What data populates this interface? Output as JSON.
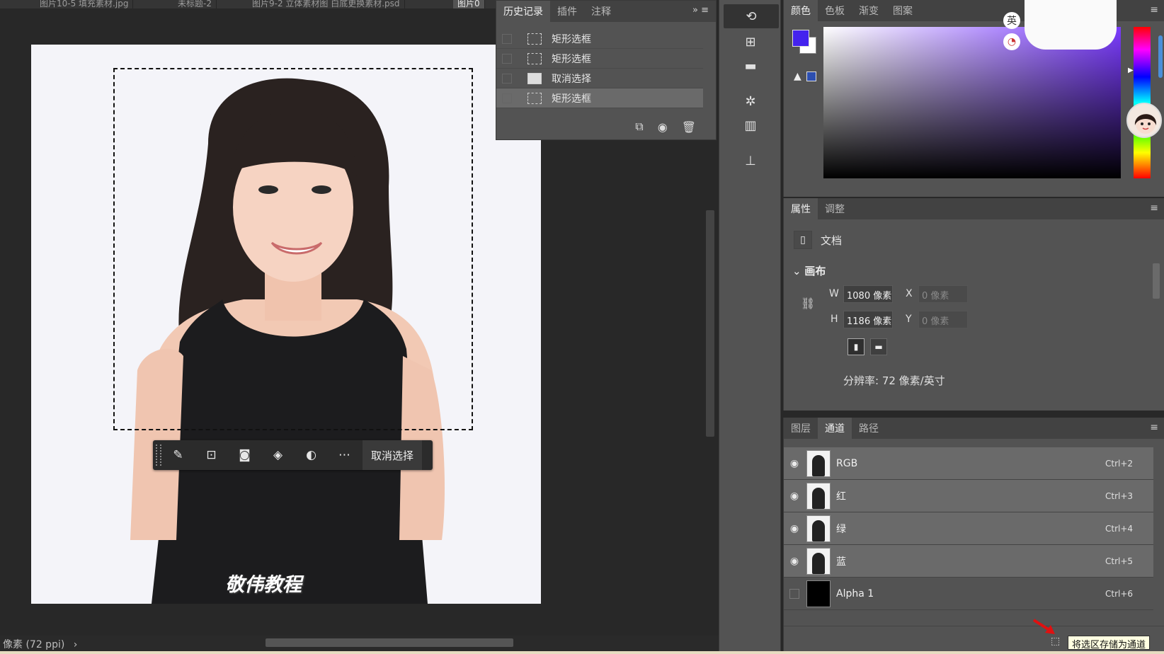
{
  "doc_tabs": [
    "图片10-5 填充素材.jpg",
    "未标题-2",
    "图片9-2 立体素材图 白底更换素材.psd",
    "图片0"
  ],
  "history": {
    "tabs": [
      "历史记录",
      "插件",
      "注释"
    ],
    "items": [
      {
        "label": "矩形选框",
        "icon": "marquee-icon"
      },
      {
        "label": "矩形选框",
        "icon": "marquee-icon"
      },
      {
        "label": "取消选择",
        "icon": "document-icon"
      },
      {
        "label": "矩形选框",
        "icon": "marquee-icon",
        "selected": true
      }
    ]
  },
  "canvas": {
    "watermark": "敬伟教程",
    "context_bar_action": "取消选择"
  },
  "color_panel": {
    "tabs": [
      "颜色",
      "色板",
      "渐变",
      "图案"
    ],
    "foreground_color": "#4422ee",
    "background_color": "#ffffff",
    "ime_badge_1": "英",
    "ime_badge_2": "◔"
  },
  "properties": {
    "tabs": [
      "属性",
      "调整"
    ],
    "doc_label": "文档",
    "section_title": "画布",
    "w_label": "W",
    "w_value": "1080 像素",
    "h_label": "H",
    "h_value": "1186 像素",
    "x_label": "X",
    "x_value": "0 像素",
    "y_label": "Y",
    "y_value": "0 像素",
    "resolution": "分辨率: 72 像素/英寸"
  },
  "channels": {
    "tabs": [
      "图层",
      "通道",
      "路径"
    ],
    "rows": [
      {
        "name": "RGB",
        "shortcut": "Ctrl+2",
        "visible": true
      },
      {
        "name": "红",
        "shortcut": "Ctrl+3",
        "visible": true
      },
      {
        "name": "绿",
        "shortcut": "Ctrl+4",
        "visible": true
      },
      {
        "name": "蓝",
        "shortcut": "Ctrl+5",
        "visible": true
      },
      {
        "name": "Alpha 1",
        "shortcut": "Ctrl+6",
        "visible": false
      }
    ],
    "tooltip": "将选区存储为通道"
  },
  "status": {
    "text": "像素 (72 ppi)"
  }
}
